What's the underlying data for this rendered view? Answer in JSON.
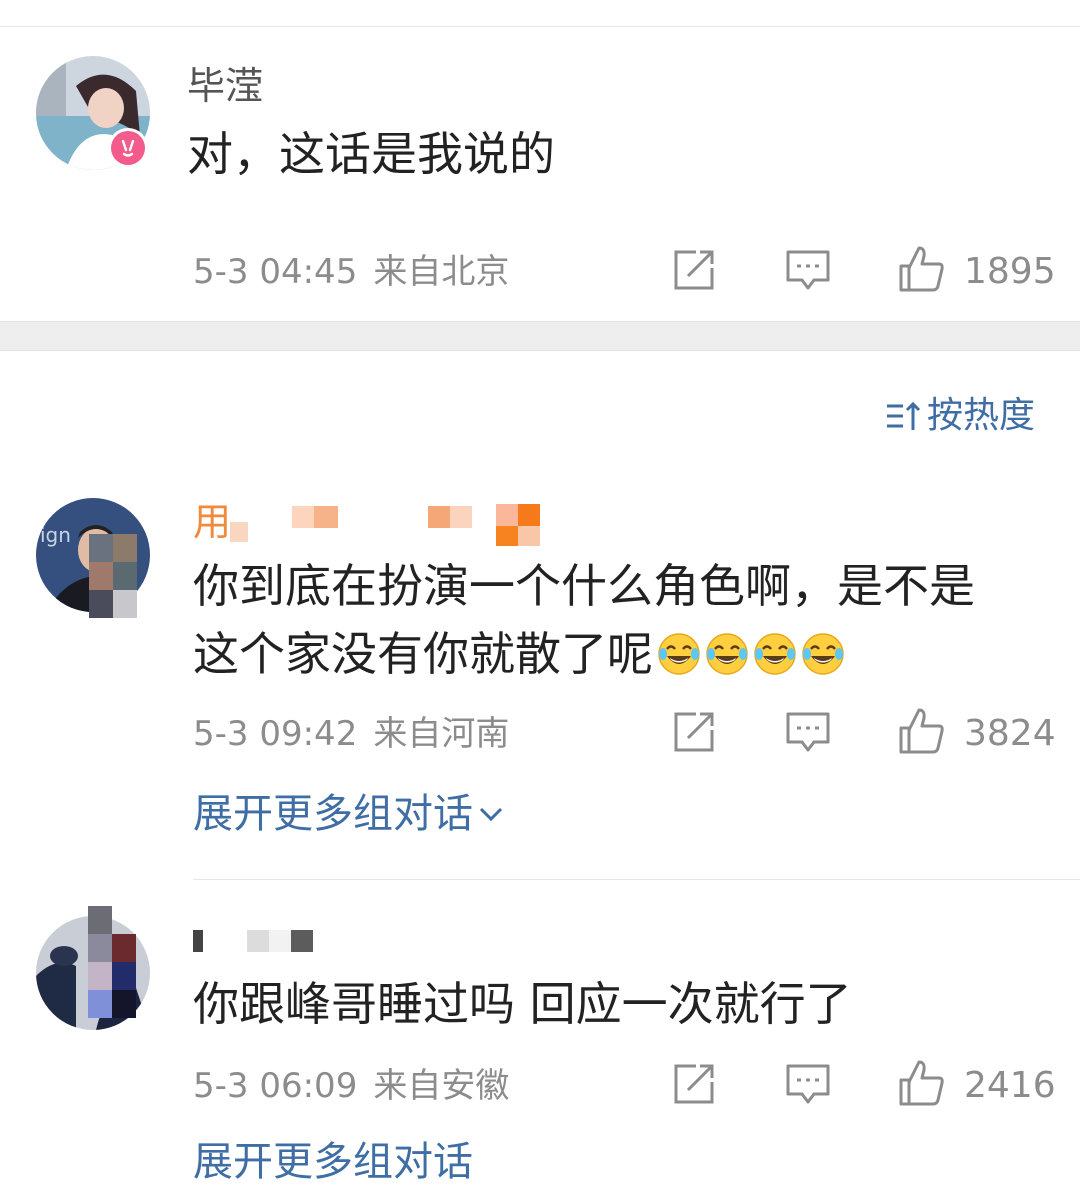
{
  "top_comment": {
    "user_name": "毕滢",
    "text": "对，这话是我说的",
    "date": "5-3 04:45",
    "source": "来自北京",
    "likes": "1895",
    "badge_color": "#f25b8c"
  },
  "sort": {
    "label": "按热度"
  },
  "comments": [
    {
      "user_name": "用",
      "line1": "你到底在扮演一个什么角色啊，是不是",
      "line2": "这个家没有你就散了呢",
      "emoji": "crying-laughing",
      "emoji_count": 4,
      "date": "5-3 09:42",
      "source": "来自河南",
      "likes": "3824",
      "more_link": "展开更多组对话"
    },
    {
      "user_name": "",
      "text": "你跟峰哥睡过吗 回应一次就行了",
      "date": "5-3 06:09",
      "source": "来自安徽",
      "likes": "2416",
      "more_link": "展开更多组对话"
    }
  ],
  "colors": {
    "link": "#3f6ea5",
    "meta": "#8c8c8c",
    "name_highlight": "#f28a3b"
  }
}
